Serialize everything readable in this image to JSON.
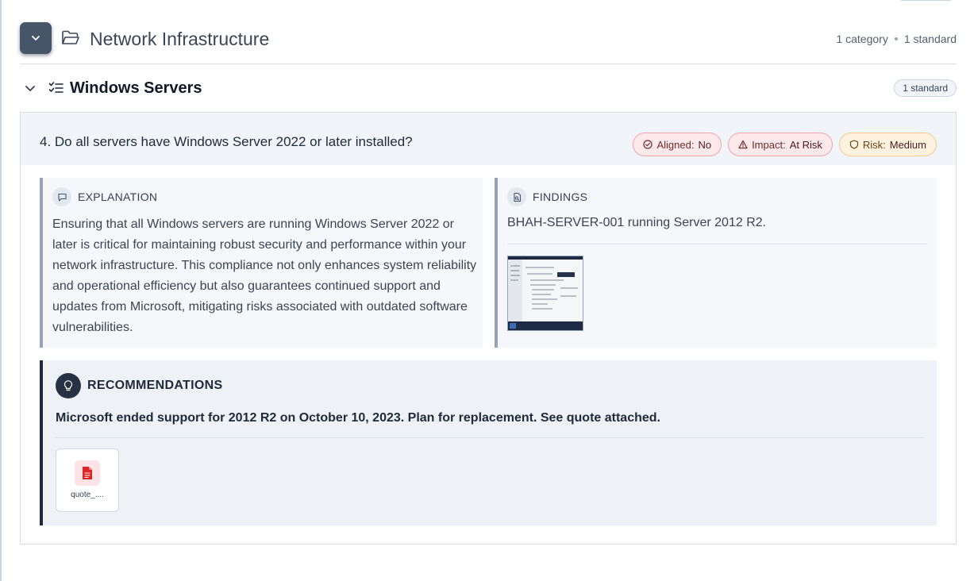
{
  "category": {
    "title": "Network Infrastructure",
    "count_label": "1 category",
    "standard_label": "1 standard",
    "toggle_icon": "chevron-down-icon",
    "icon": "folder-open-icon"
  },
  "subcategory": {
    "title": "Windows Servers",
    "badge": "1 standard",
    "icon": "list-check-icon"
  },
  "standard": {
    "question": "4. Do all servers have Windows Server 2022 or later installed?",
    "badges": [
      {
        "label": "Aligned:",
        "value": "No",
        "icon": "check-circle-icon",
        "tone": "#fde8ea"
      },
      {
        "label": "Impact:",
        "value": "At Risk",
        "icon": "warning-triangle-icon",
        "tone": "#fde8ea"
      },
      {
        "label": "Risk:",
        "value": "Medium",
        "icon": "shield-icon",
        "tone": "#fff3df"
      }
    ],
    "explanation": {
      "label": "EXPLANATION",
      "text": "Ensuring that all Windows servers are running Windows Server 2022 or later is critical for maintaining robust security and performance within your network infrastructure. This compliance not only enhances system reliability and operational efficiency but also guarantees continued support and updates from Microsoft, mitigating risks associated with outdated software vulnerabilities."
    },
    "findings": {
      "label": "FINDINGS",
      "text": "BHAH-SERVER-001 running Server 2012 R2."
    },
    "recommendations": {
      "label": "RECOMMENDATIONS",
      "text": "Microsoft ended support for 2012 R2 on October 10, 2023. Plan for replacement. See quote attached.",
      "attachment_name": "quote_...."
    }
  },
  "colors": {
    "accent_dark": "#1e293b",
    "danger_bg": "#fde8ea",
    "warning_bg": "#fff3df",
    "pdf_red": "#dc2626"
  }
}
